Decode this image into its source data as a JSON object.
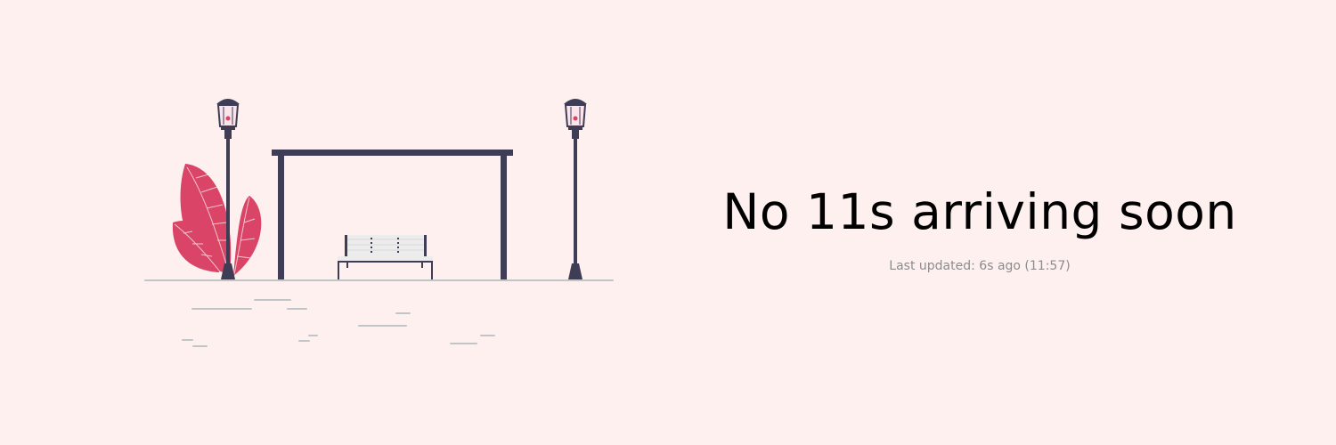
{
  "status": {
    "headline": "No 11s arriving soon",
    "last_updated": "Last updated: 6s ago (11:57)"
  },
  "illustration": {
    "scene": "empty-bus-stop",
    "icons": [
      "lamp-post-icon",
      "bus-shelter-icon",
      "bench-icon",
      "plant-icon"
    ]
  },
  "colors": {
    "background": "#fff0f0",
    "accent": "#d94467",
    "structure": "#3f3d56",
    "ground": "#c2c5c8",
    "headline_text": "#000000",
    "muted_text": "#8c8c8c"
  }
}
